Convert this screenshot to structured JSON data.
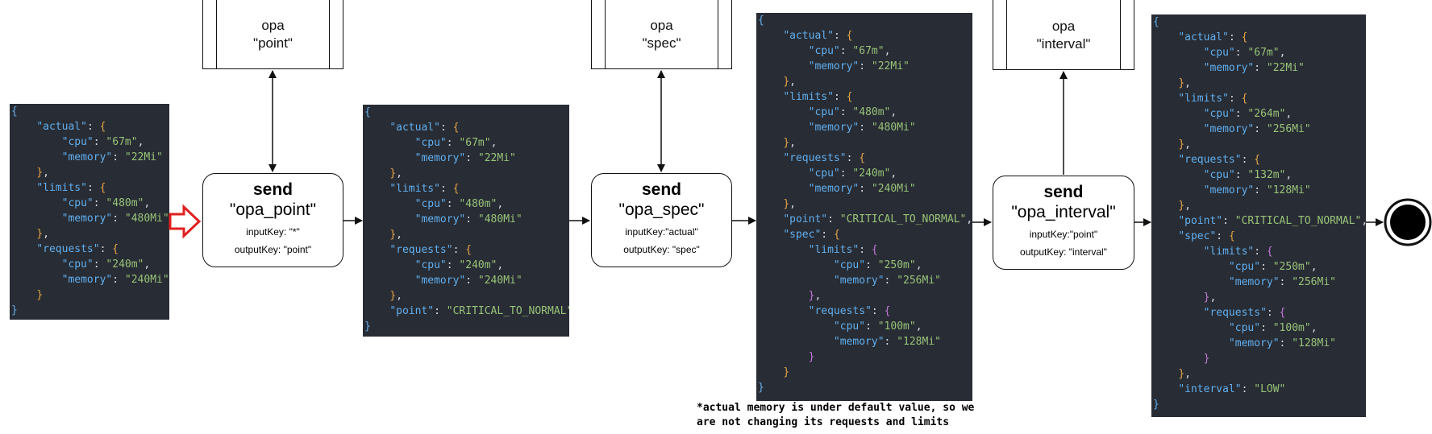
{
  "json_blocks": {
    "input": [
      "{",
      "\"actual\": {",
      "\"cpu\": \"67m\",",
      "\"memory\": \"22Mi\"",
      "},",
      "\"limits\": {",
      "\"cpu\": \"480m\",",
      "\"memory\": \"480Mi\"",
      "},",
      "\"requests\": {",
      "\"cpu\": \"240m\",",
      "\"memory\": \"240Mi\"",
      "}",
      "}"
    ],
    "after_point": [
      "{",
      "\"actual\": {",
      "\"cpu\": \"67m\",",
      "\"memory\": \"22Mi\"",
      "},",
      "\"limits\": {",
      "\"cpu\": \"480m\",",
      "\"memory\": \"480Mi\"",
      "},",
      "\"requests\": {",
      "\"cpu\": \"240m\",",
      "\"memory\": \"240Mi\"",
      "},",
      "\"point\": \"CRITICAL_TO_NORMAL\"",
      "}"
    ],
    "after_spec": [
      "{",
      "\"actual\": {",
      "\"cpu\": \"67m\",",
      "\"memory\": \"22Mi\"",
      "},",
      "\"limits\": {",
      "\"cpu\": \"480m\",",
      "\"memory\": \"480Mi\"",
      "},",
      "\"requests\": {",
      "\"cpu\": \"240m\",",
      "\"memory\": \"240Mi\"",
      "},",
      "\"point\": \"CRITICAL_TO_NORMAL\",",
      "\"spec\": {",
      "\"limits\": {",
      "\"cpu\": \"250m\",",
      "\"memory\": \"256Mi\"",
      "},",
      "\"requests\": {",
      "\"cpu\": \"100m\",",
      "\"memory\": \"128Mi\"",
      "}",
      "}",
      "}"
    ],
    "after_interval": [
      "{",
      "\"actual\": {",
      "\"cpu\": \"67m\",",
      "\"memory\": \"22Mi\"",
      "},",
      "\"limits\": {",
      "\"cpu\": \"264m\",",
      "\"memory\": \"256Mi\"",
      "},",
      "\"requests\": {",
      "\"cpu\": \"132m\",",
      "\"memory\": \"128Mi\"",
      "},",
      "\"point\": \"CRITICAL_TO_NORMAL\",",
      "\"spec\": {",
      "\"limits\": {",
      "\"cpu\": \"250m\",",
      "\"memory\": \"256Mi\"",
      "},",
      "\"requests\": {",
      "\"cpu\": \"100m\",",
      "\"memory\": \"128Mi\"",
      "}",
      "},",
      "\"interval\": \"LOW\"",
      "}"
    ]
  },
  "opa_nodes": {
    "point": {
      "line1": "opa",
      "line2": "\"point\""
    },
    "spec": {
      "line1": "opa",
      "line2": "\"spec\""
    },
    "interval": {
      "line1": "opa",
      "line2": "\"interval\""
    }
  },
  "send_nodes": {
    "point": {
      "title": "send",
      "name": "\"opa_point\"",
      "input_key": "inputKey: \"*\"",
      "output_key": "outputKey: \"point\""
    },
    "spec": {
      "title": "send",
      "name": "\"opa_spec\"",
      "input_key": "inputKey:\"actual\"",
      "output_key": "outputKey: \"spec\""
    },
    "interval": {
      "title": "send",
      "name": "\"opa_interval\"",
      "input_key": "inputKey:\"point\"",
      "output_key": "outputKey: \"interval\""
    }
  },
  "note": "*actual memory is under default value, so we\nare not changing its requests and limits",
  "colors": {
    "code_bg": "#282c34",
    "key": "#61afef",
    "string": "#98c379",
    "brace_l1": "#e5a449",
    "brace_l2": "#c678dd",
    "start_arrow": "#e02020"
  }
}
